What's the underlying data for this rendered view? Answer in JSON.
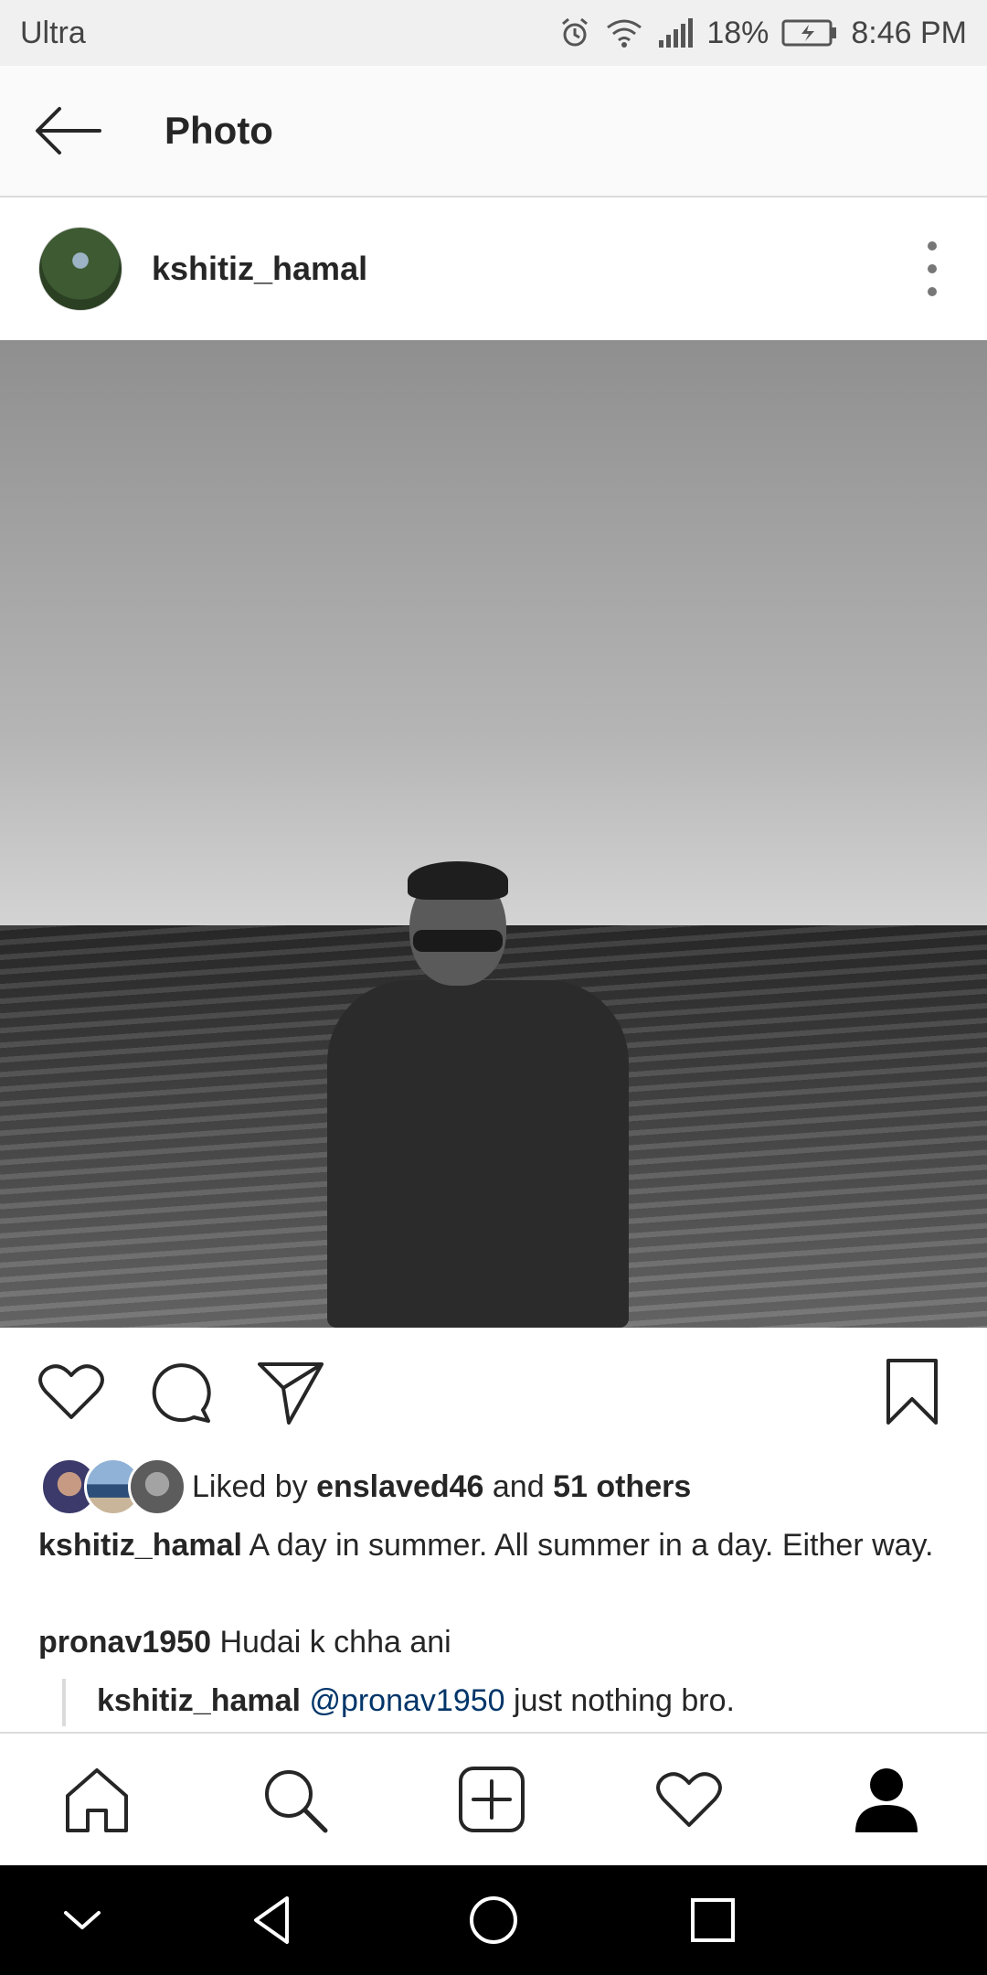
{
  "status_bar": {
    "carrier": "Ultra",
    "battery_percent": "18%",
    "time": "8:46 PM"
  },
  "app_bar": {
    "title": "Photo"
  },
  "post": {
    "username": "kshitiz_hamal",
    "likes_prefix": "Liked by ",
    "liked_by_user": "enslaved46",
    "likes_and": " and ",
    "likes_others": "51 others",
    "caption_user": "kshitiz_hamal",
    "caption_text": " A day in summer. All summer in a day. Either way.",
    "comment_user": "pronav1950",
    "comment_text": " Hudai k chha ani",
    "reply_user": "kshitiz_hamal",
    "reply_mention": "@pronav1950",
    "reply_text": " just nothing bro."
  },
  "colors": {
    "mention": "#003569",
    "text": "#262626",
    "divider": "#dbdbdb"
  },
  "icons": {
    "back": "arrow-left-icon",
    "more": "vertical-dots-icon",
    "like": "heart-icon",
    "comment": "speech-bubble-icon",
    "share": "paper-plane-icon",
    "save": "bookmark-icon",
    "home": "home-icon",
    "search": "search-icon",
    "add": "plus-square-icon",
    "activity": "heart-icon",
    "profile": "person-icon"
  }
}
